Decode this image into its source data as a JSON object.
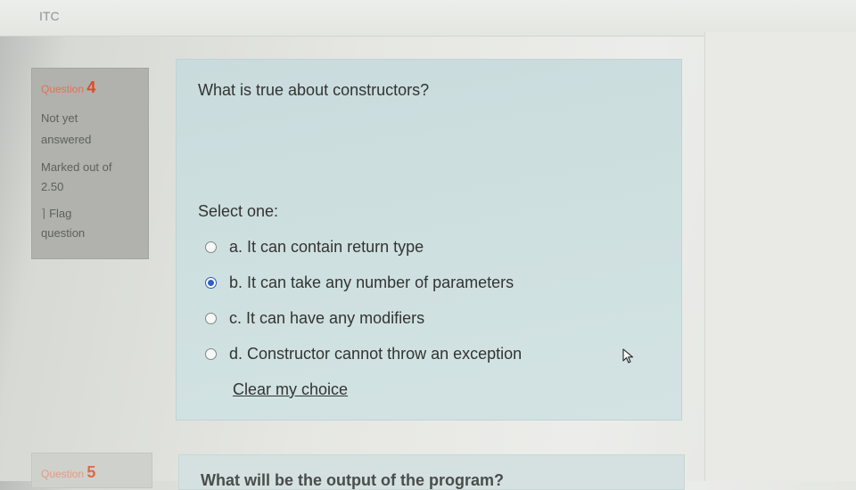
{
  "app": {
    "title": "ITC"
  },
  "question4": {
    "label": "Question",
    "number": "4",
    "state": [
      "Not yet",
      "answered"
    ],
    "marks": [
      "Marked out of",
      "2.50"
    ],
    "flag": [
      "Flag",
      "question"
    ],
    "text": "What is true about constructors?",
    "prompt": "Select one:",
    "options": [
      {
        "label": "a. It can contain return type",
        "selected": false
      },
      {
        "label": "b. It can take any number of parameters",
        "selected": true
      },
      {
        "label": "c. It can have any modifiers",
        "selected": false
      },
      {
        "label": "d. Constructor cannot throw an exception",
        "selected": false
      }
    ],
    "clear_label": "Clear my choice"
  },
  "question5": {
    "label": "Question",
    "number": "5",
    "text": "What will be the output of the program?"
  },
  "colors": {
    "question_number": "#de4a2a",
    "content_bg": "#cfe0e0",
    "radio_selected": "#2f5fc4"
  }
}
